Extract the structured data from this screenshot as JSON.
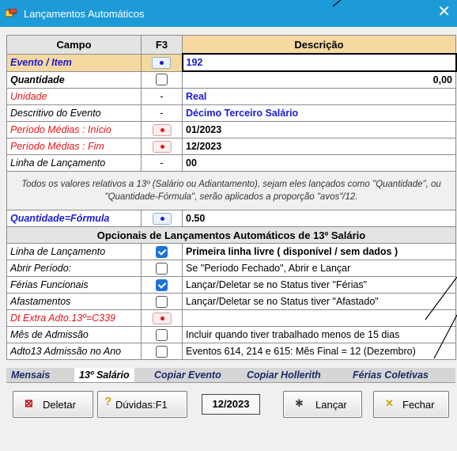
{
  "window": {
    "title": "Lançamentos Automáticos",
    "close": "✕"
  },
  "table": {
    "headers": {
      "campo": "Campo",
      "f3": "F3",
      "descricao": "Descrição"
    },
    "rows": [
      {
        "label": "Evento / Item",
        "value": "192"
      },
      {
        "label": "Quantidade",
        "value": "0,00"
      },
      {
        "label": "Unidade",
        "f3": "-",
        "value": "Real"
      },
      {
        "label": "Descritivo do Evento",
        "f3": "-",
        "value": "Décimo Terceiro Salário"
      },
      {
        "label": "Período Médias : Início",
        "value": "01/2023"
      },
      {
        "label": "Período Médias : Fim",
        "value": "12/2023"
      },
      {
        "label": "Linha de Lançamento",
        "f3": "-",
        "value": "00"
      }
    ],
    "note": "Todos os valores relativos a 13º (Salário ou Adiantamento), sejam eles lançados como \"Quantidade\", ou \"Quantidade-Fórmula\", serão aplicados a proporção \"avos\"/12.",
    "formula": {
      "label": "Quantidade=Fórmula",
      "value": "0.50"
    },
    "section_title": "Opcionais de Lançamentos Automáticos de 13º Salário",
    "options": [
      {
        "label": "Linha de Lançamento",
        "checked": true,
        "value": "Primeira linha livre ( disponível / sem dados )"
      },
      {
        "label": "Abrir Período:",
        "checked": false,
        "value": "Se \"Período Fechado\", Abrir e Lançar"
      },
      {
        "label": "Férias Funcionais",
        "checked": true,
        "value": "Lançar/Deletar se no Status tiver \"Férias\""
      },
      {
        "label": "Afastamentos",
        "checked": false,
        "value": "Lançar/Deletar se no Status tiver \"Afastado\""
      },
      {
        "label": "Dt Extra Adto.13º=C339",
        "value": ""
      },
      {
        "label": "Mês de Admissão",
        "checked": false,
        "value": "Incluir quando tiver trabalhado menos de 15 dias"
      },
      {
        "label": "Adto13 Admissão no Ano",
        "checked": false,
        "value": "Eventos 614, 214 e 615: Mês Final = 12 (Dezembro)"
      }
    ]
  },
  "tabs": [
    "Mensais",
    "13º Salário",
    "Copiar Evento",
    "Copiar Hollerith",
    "Férias Coletivas"
  ],
  "active_tab": "13º Salário",
  "buttons": {
    "deletar": "Deletar",
    "duvidas": "Dúvidas:F1",
    "date": "12/2023",
    "lancar": "Lançar",
    "fechar": "Fechar"
  },
  "colors": {
    "titlebar": "#1d9ad8",
    "header_desc": "#f5d9a0",
    "red_label": "#e2151b",
    "blue_label": "#1b1bd6",
    "checkbox_on": "#1a73d9"
  }
}
